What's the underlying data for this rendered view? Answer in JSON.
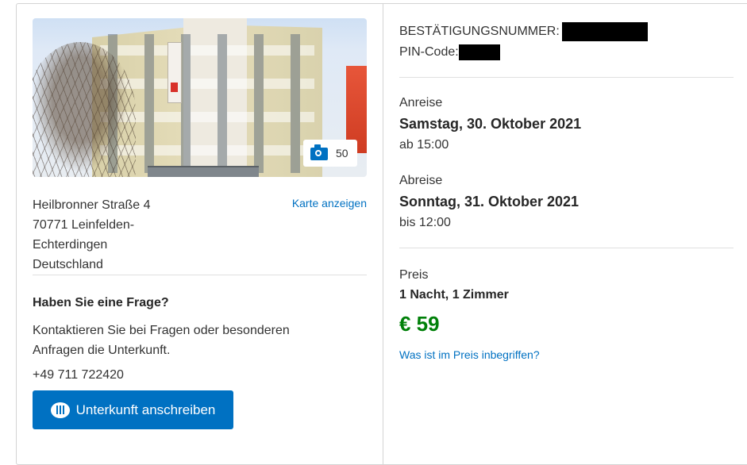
{
  "photo": {
    "count": "50",
    "icon": "camera-icon"
  },
  "address": {
    "line1": "Heilbronner Straße 4",
    "line2": "70771 Leinfelden-",
    "line3": "Echterdingen",
    "line4": "Deutschland",
    "map_link": "Karte anzeigen"
  },
  "contact": {
    "heading": "Haben Sie eine Frage?",
    "text": "Kontaktieren Sie bei Fragen oder besonderen Anfragen die Unterkunft.",
    "phone": "+49 711 722420",
    "button_label": "Unterkunft anschreiben",
    "button_icon": "chat-icon"
  },
  "booking": {
    "confirmation_label": "BESTÄTIGUNGSNUMMER:",
    "pin_label": "PIN-Code:"
  },
  "checkin": {
    "label": "Anreise",
    "date": "Samstag, 30. Oktober 2021",
    "time": "ab 15:00"
  },
  "checkout": {
    "label": "Abreise",
    "date": "Sonntag, 31. Oktober 2021",
    "time": "bis 12:00"
  },
  "price": {
    "label": "Preis",
    "summary": "1 Nacht, 1 Zimmer",
    "amount": "€ 59",
    "included_link": "Was ist im Preis inbegriffen?"
  },
  "colors": {
    "accent": "#0071c2",
    "price_green": "#008009"
  }
}
